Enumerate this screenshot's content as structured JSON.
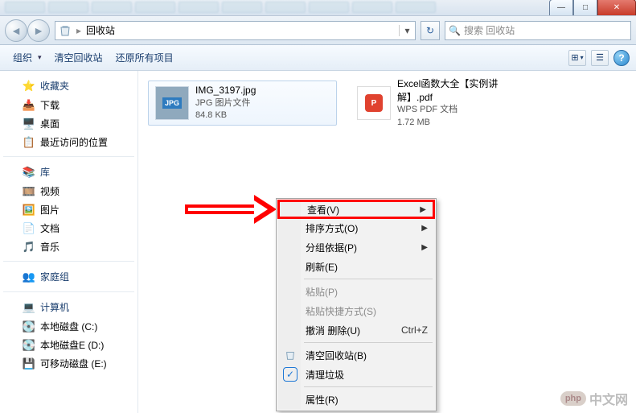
{
  "window": {
    "title": "回收站",
    "min_glyph": "—",
    "max_glyph": "□",
    "close_glyph": "✕"
  },
  "address": {
    "location_label": "回收站",
    "dropdown_glyph": "▾",
    "refresh_glyph": "↻",
    "back_glyph": "◄",
    "fwd_glyph": "►"
  },
  "search": {
    "placeholder": "搜索 回收站",
    "icon": "🔍"
  },
  "toolbar": {
    "organize": "组织",
    "empty_bin": "清空回收站",
    "restore_all": "还原所有项目",
    "view_icon": "⊞",
    "tile_icon": "☰",
    "help_glyph": "?"
  },
  "sidebar": {
    "favorites_header": "收藏夹",
    "downloads": "下载",
    "desktop": "桌面",
    "recent": "最近访问的位置",
    "libraries_header": "库",
    "videos": "视频",
    "pictures": "图片",
    "documents": "文档",
    "music": "音乐",
    "homegroup_header": "家庭组",
    "computer_header": "计算机",
    "disk_c": "本地磁盘 (C:)",
    "disk_d": "本地磁盘E (D:)",
    "disk_e": "可移动磁盘 (E:)"
  },
  "files": [
    {
      "name": "IMG_3197.jpg",
      "type_label": "JPG 图片文件",
      "size": "84.8 KB",
      "badge": "JPG"
    },
    {
      "name": "Excel函数大全【实例讲解】.pdf",
      "type_label": "WPS PDF 文档",
      "size": "1.72 MB",
      "badge": "P"
    }
  ],
  "context_menu": {
    "view": "查看(V)",
    "sort": "排序方式(O)",
    "group": "分组依据(P)",
    "refresh": "刷新(E)",
    "paste": "粘贴(P)",
    "paste_shortcut": "粘贴快捷方式(S)",
    "undo_delete": "撤消 删除(U)",
    "undo_shortcut": "Ctrl+Z",
    "empty_bin": "清空回收站(B)",
    "clean_junk": "清理垃圾",
    "properties": "属性(R)"
  },
  "watermark": {
    "badge": "php",
    "text": "中文网"
  }
}
